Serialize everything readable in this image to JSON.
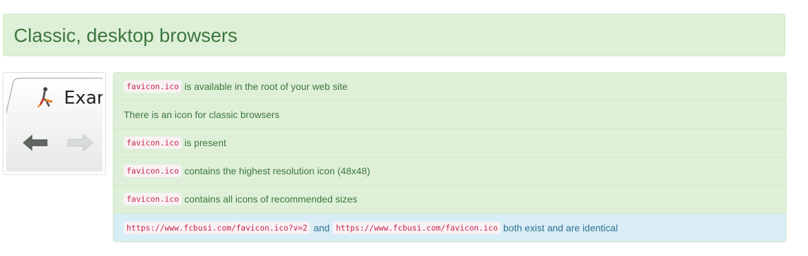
{
  "panel": {
    "title": "Classic, desktop browsers"
  },
  "thumbnail": {
    "tab_text": "Exam",
    "icons": [
      "favicon-figure-icon",
      "back-arrow-icon",
      "forward-arrow-icon"
    ]
  },
  "checks": [
    {
      "code": "favicon.ico",
      "text": "is available in the root of your web site",
      "status": "success"
    },
    {
      "text": "There is an icon for classic browsers",
      "status": "success"
    },
    {
      "code": "favicon.ico",
      "text": "is present",
      "status": "success"
    },
    {
      "code": "favicon.ico",
      "text": "contains the highest resolution icon (48x48)",
      "status": "success"
    },
    {
      "code": "favicon.ico",
      "text": "contains all icons of recommended sizes",
      "status": "success"
    },
    {
      "code": "https://www.fcbusi.com/favicon.ico?v=2",
      "mid": "and",
      "code2": "https://www.fcbusi.com/favicon.ico",
      "text": "both exist and are identical",
      "status": "info"
    }
  ],
  "colors": {
    "success_bg": "#dff0d8",
    "success_text": "#3c763d",
    "info_bg": "#d9edf7",
    "info_text": "#31708f",
    "code_text": "#c7254e"
  }
}
